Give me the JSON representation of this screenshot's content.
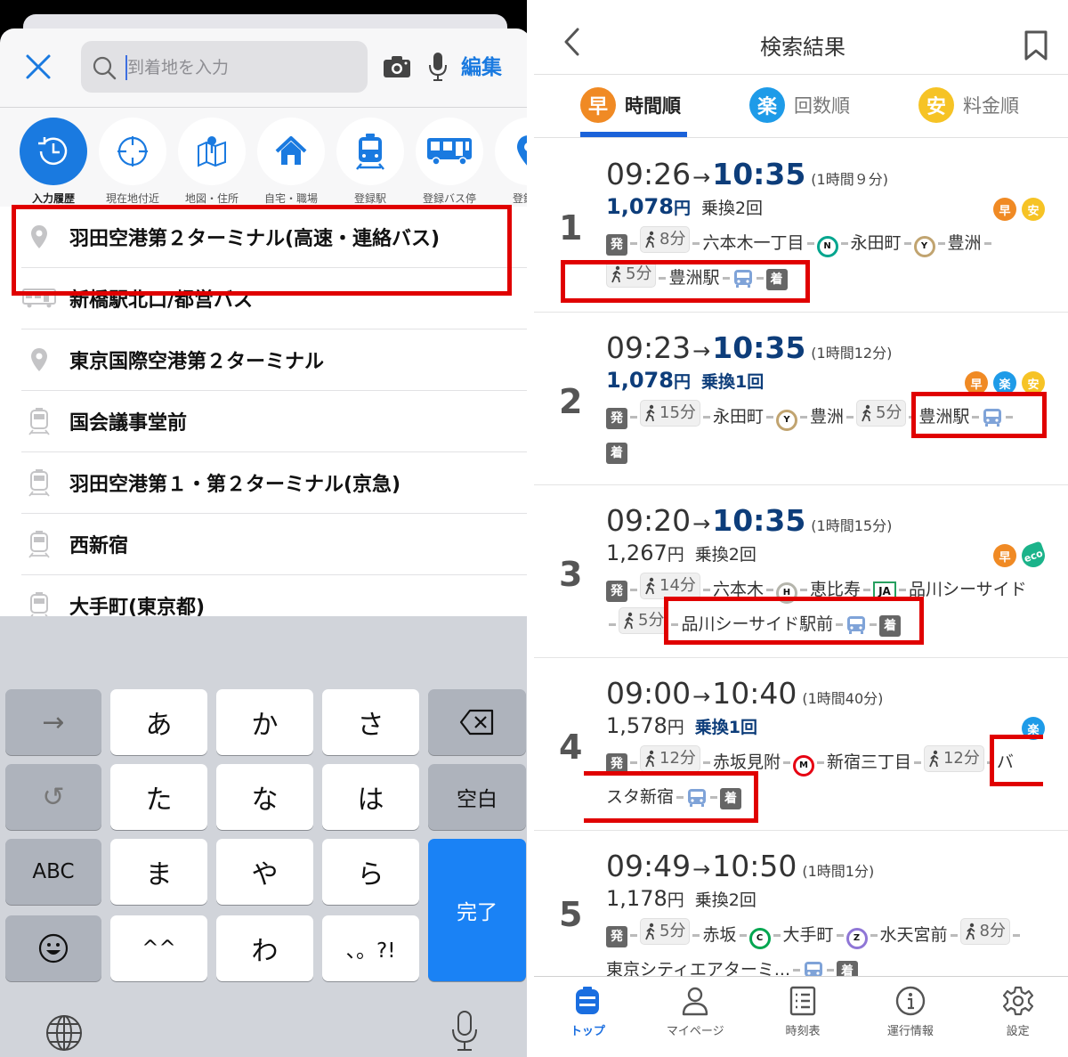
{
  "left": {
    "search": {
      "placeholder": "到着地を入力",
      "edit_label": "編集"
    },
    "shortcuts": [
      {
        "label": "入力履歴",
        "icon": "history-icon"
      },
      {
        "label": "現在地付近",
        "icon": "location-crosshair-icon"
      },
      {
        "label": "地図・住所",
        "icon": "map-pin-icon"
      },
      {
        "label": "自宅・職場",
        "icon": "home-icon"
      },
      {
        "label": "登録駅",
        "icon": "train-icon"
      },
      {
        "label": "登録バス停",
        "icon": "bus-icon"
      },
      {
        "label": "登録ス",
        "icon": "pin-icon"
      }
    ],
    "history": [
      {
        "label": "羽田空港第２ターミナル(高速・連絡バス)",
        "icon": "pin-icon"
      },
      {
        "label": "新橋駅北口/都営バス",
        "icon": "bus-icon"
      },
      {
        "label": "東京国際空港第２ターミナル",
        "icon": "pin-icon"
      },
      {
        "label": "国会議事堂前",
        "icon": "train-icon"
      },
      {
        "label": "羽田空港第１・第２ターミナル(京急)",
        "icon": "train-icon"
      },
      {
        "label": "西新宿",
        "icon": "train-icon"
      },
      {
        "label": "大手町(東京都)",
        "icon": "train-icon"
      }
    ],
    "keyboard": {
      "row1": [
        "→",
        "あ",
        "か",
        "さ",
        "⌫"
      ],
      "row2": [
        "↺",
        "た",
        "な",
        "は",
        "空白"
      ],
      "row3": [
        "ABC",
        "ま",
        "や",
        "ら"
      ],
      "row4": [
        "☺",
        "^^",
        "わ",
        "、。?!"
      ],
      "done": "完了"
    }
  },
  "right": {
    "header": {
      "title": "検索結果"
    },
    "tabs": [
      {
        "badge": "早",
        "label": "時間順",
        "color": "#f08a24",
        "active": true
      },
      {
        "badge": "楽",
        "label": "回数順",
        "color": "#1e9be8",
        "active": false
      },
      {
        "badge": "安",
        "label": "料金順",
        "color": "#f6c325",
        "active": false
      }
    ],
    "routes": [
      {
        "num": "1",
        "dep": "09:26",
        "arr": "10:35",
        "dur": "(1時間９分)",
        "fare": "1,078",
        "yen": "円",
        "xfer": "乗換2回",
        "tags": [
          {
            "t": "早",
            "c": "#f08a24"
          },
          {
            "t": "安",
            "c": "#f6c325"
          }
        ],
        "path1": [
          {
            "type": "sq",
            "t": "発"
          },
          {
            "type": "walk",
            "t": "8分"
          },
          {
            "type": "txt",
            "t": "六本木一丁目"
          },
          {
            "type": "line",
            "t": "N",
            "c": "#00a58e"
          },
          {
            "type": "txt",
            "t": "永田町"
          },
          {
            "type": "line",
            "t": "Y",
            "c": "#c1a470"
          },
          {
            "type": "txt",
            "t": "豊洲"
          }
        ],
        "path2": [
          {
            "type": "walk",
            "t": "5分"
          },
          {
            "type": "txt",
            "t": "豊洲駅"
          },
          {
            "type": "bus"
          },
          {
            "type": "sq",
            "t": "着"
          }
        ]
      },
      {
        "num": "2",
        "dep": "09:23",
        "arr": "10:35",
        "dur": "(1時間12分)",
        "fare": "1,078",
        "yen": "円",
        "xfer": "乗換1回",
        "tags": [
          {
            "t": "早",
            "c": "#f08a24"
          },
          {
            "t": "楽",
            "c": "#1e9be8"
          },
          {
            "t": "安",
            "c": "#f6c325"
          }
        ],
        "path1": [
          {
            "type": "sq",
            "t": "発"
          },
          {
            "type": "walk",
            "t": "15分"
          },
          {
            "type": "txt",
            "t": "永田町"
          },
          {
            "type": "line",
            "t": "Y",
            "c": "#c1a470"
          },
          {
            "type": "txt",
            "t": "豊洲"
          },
          {
            "type": "walk",
            "t": "5分"
          },
          {
            "type": "txt",
            "t": "豊洲駅"
          },
          {
            "type": "bus"
          }
        ],
        "path2": [
          {
            "type": "sq",
            "t": "着"
          }
        ]
      },
      {
        "num": "3",
        "dep": "09:20",
        "arr": "10:35",
        "dur": "(1時間15分)",
        "fare": "1,267",
        "yen": "円",
        "xfer": "乗換2回",
        "tags": [
          {
            "t": "早",
            "c": "#f08a24"
          },
          {
            "t": "eco",
            "c": "#1bb38a"
          }
        ],
        "path1": [
          {
            "type": "sq",
            "t": "発"
          },
          {
            "type": "walk",
            "t": "14分"
          },
          {
            "type": "txt",
            "t": "六本木"
          },
          {
            "type": "line",
            "t": "H",
            "c": "#b5b5ac"
          },
          {
            "type": "txt",
            "t": "恵比寿"
          },
          {
            "type": "jr",
            "t": "JA"
          },
          {
            "type": "txt",
            "t": "品川シーサイド"
          }
        ],
        "path2": [
          {
            "type": "walk",
            "t": "5分"
          },
          {
            "type": "txt",
            "t": "品川シーサイド駅前"
          },
          {
            "type": "bus"
          },
          {
            "type": "sq",
            "t": "着"
          }
        ]
      },
      {
        "num": "4",
        "dep": "09:00",
        "arr": "10:40",
        "dur": "(1時間40分)",
        "fare": "1,578",
        "yen": "円",
        "xfer": "乗換1回",
        "tags": [
          {
            "t": "楽",
            "c": "#1e9be8"
          }
        ],
        "path1": [
          {
            "type": "sq",
            "t": "発"
          },
          {
            "type": "walk",
            "t": "12分"
          },
          {
            "type": "txt",
            "t": "赤坂見附"
          },
          {
            "type": "line",
            "t": "M",
            "c": "#e60012"
          },
          {
            "type": "txt",
            "t": "新宿三丁目"
          },
          {
            "type": "walk",
            "t": "12分"
          },
          {
            "type": "txt",
            "t": "バ"
          }
        ],
        "path2": [
          {
            "type": "txt",
            "t": "スタ新宿"
          },
          {
            "type": "bus"
          },
          {
            "type": "sq",
            "t": "着"
          }
        ]
      },
      {
        "num": "5",
        "dep": "09:49",
        "arr": "10:50",
        "dur": "(1時間1分)",
        "fare": "1,178",
        "yen": "円",
        "xfer": "乗換2回",
        "tags": [],
        "path1": [
          {
            "type": "sq",
            "t": "発"
          },
          {
            "type": "walk",
            "t": "5分"
          },
          {
            "type": "txt",
            "t": "赤坂"
          },
          {
            "type": "line",
            "t": "C",
            "c": "#00a650"
          },
          {
            "type": "txt",
            "t": "大手町"
          },
          {
            "type": "line",
            "t": "Z",
            "c": "#8f76d6"
          },
          {
            "type": "txt",
            "t": "水天宮前"
          },
          {
            "type": "walk",
            "t": "8分"
          }
        ],
        "path2": [
          {
            "type": "txt",
            "t": "東京シティエアターミ..."
          },
          {
            "type": "bus"
          },
          {
            "type": "sq",
            "t": "着"
          }
        ]
      }
    ],
    "bottom_nav": [
      {
        "label": "トップ",
        "icon": "train-top-icon",
        "active": true
      },
      {
        "label": "マイページ",
        "icon": "person-icon",
        "active": false
      },
      {
        "label": "時刻表",
        "icon": "timetable-icon",
        "active": false
      },
      {
        "label": "運行情報",
        "icon": "info-icon",
        "active": false
      },
      {
        "label": "設定",
        "icon": "gear-icon",
        "active": false
      }
    ]
  }
}
